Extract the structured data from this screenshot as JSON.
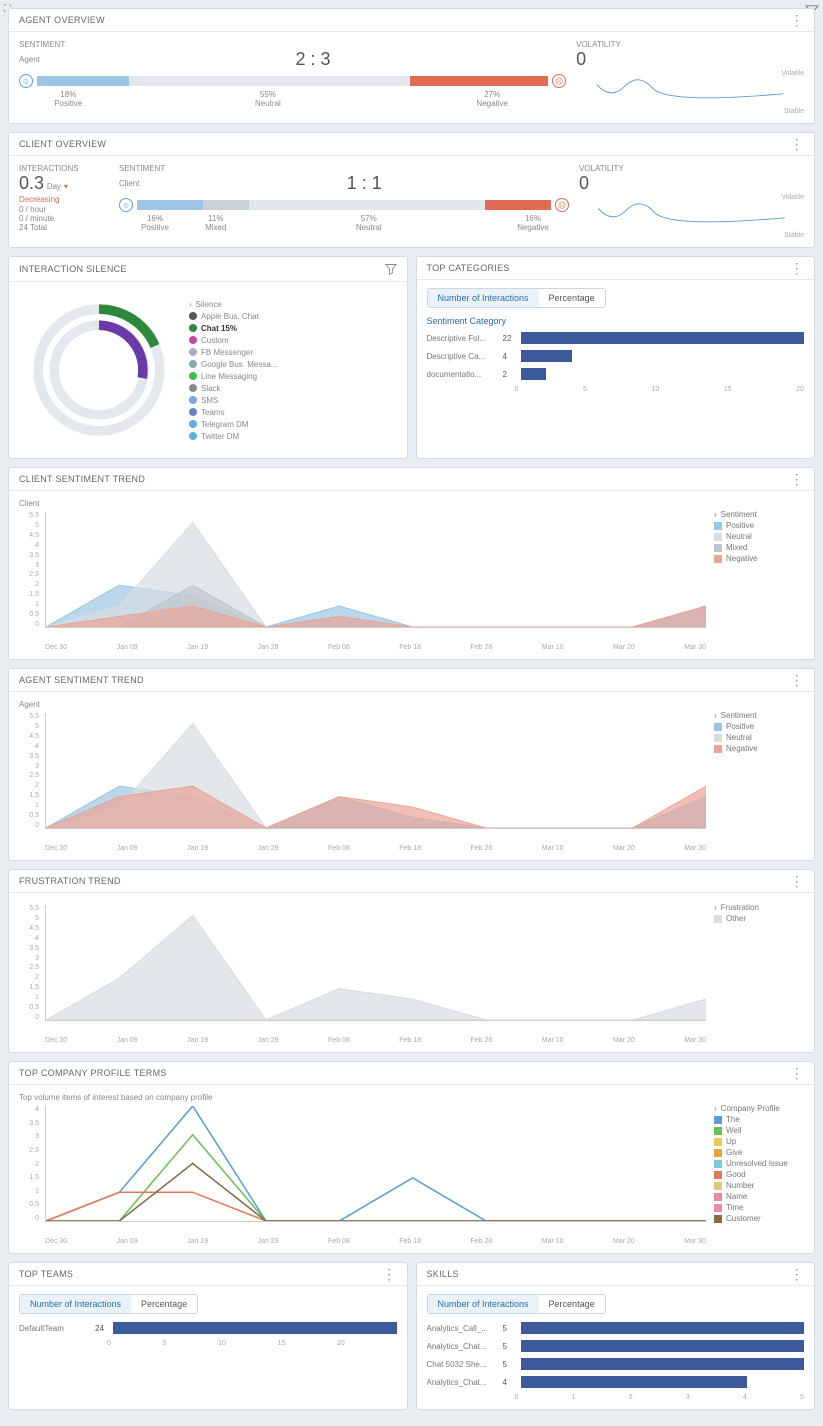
{
  "agent_overview": {
    "title": "AGENT OVERVIEW",
    "sentiment_label": "SENTIMENT",
    "sub": "Agent",
    "ratio": "2 : 3",
    "segments": [
      {
        "pct": 18,
        "label": "Positive",
        "color": "#9cc6e4"
      },
      {
        "pct": 55,
        "label": "Neutral",
        "color": "#e3e8ec"
      },
      {
        "pct": 27,
        "label": "Negative",
        "color": "#e06a52"
      }
    ],
    "volatility_label": "VOLATILITY",
    "volatility": "0",
    "vol_note": "Volatile",
    "vol_foot": "Stable"
  },
  "client_overview": {
    "title": "CLIENT OVERVIEW",
    "interactions_label": "INTERACTIONS",
    "interactions": "0.3",
    "interactions_unit": "Day",
    "trend": "Decreasing",
    "lines": [
      "0 / hour",
      "0 / minute",
      "24 Total"
    ],
    "sentiment_label": "SENTIMENT",
    "sub": "Client",
    "ratio": "1 : 1",
    "segments": [
      {
        "pct": 16,
        "label": "Positive",
        "color": "#9cc6e4"
      },
      {
        "pct": 11,
        "label": "Mixed",
        "color": "#c9d2d9"
      },
      {
        "pct": 57,
        "label": "Neutral",
        "color": "#e3e8ec"
      },
      {
        "pct": 16,
        "label": "Negative",
        "color": "#e06a52"
      }
    ],
    "volatility_label": "VOLATILITY",
    "volatility": "0",
    "vol_note": "Volatile",
    "vol_foot": "Stable"
  },
  "interaction_silence": {
    "title": "INTERACTION SILENCE",
    "group": "Silence",
    "items": [
      {
        "label": "Apple Bus. Chat",
        "color": "#555"
      },
      {
        "label": "Chat 15%",
        "color": "#2a8a3a",
        "bold": true
      },
      {
        "label": "Custom",
        "color": "#c04aa8"
      },
      {
        "label": "FB Messenger",
        "color": "#b6a3d8"
      },
      {
        "label": "Google Bus. Messa...",
        "color": "#8aa"
      },
      {
        "label": "Line Messaging",
        "color": "#3bbf4a"
      },
      {
        "label": "Slack",
        "color": "#888"
      },
      {
        "label": "SMS",
        "color": "#7aa8d8"
      },
      {
        "label": "Teams",
        "color": "#6a7fc4"
      },
      {
        "label": "Telegram DM",
        "color": "#5ab3d8"
      },
      {
        "label": "Twitter DM",
        "color": "#5ab3d8"
      }
    ]
  },
  "top_categories": {
    "title": "TOP CATEGORIES",
    "tabs": [
      "Number of Interactions",
      "Percentage"
    ],
    "active_tab": 0,
    "subtitle": "Sentiment Category",
    "rows": [
      {
        "label": "Descriptive Fol...",
        "val": 22
      },
      {
        "label": "Descriptive Ca...",
        "val": 4
      },
      {
        "label": "documentatio...",
        "val": 2
      }
    ],
    "ticks": [
      "0",
      "5",
      "10",
      "15",
      "20"
    ],
    "max": 22
  },
  "trend_common": {
    "yticks": [
      "0",
      "0.5",
      "1",
      "1.5",
      "2",
      "2.5",
      "3",
      "3.5",
      "4",
      "4.5",
      "5",
      "5.5"
    ],
    "xticks": [
      "Dec 30",
      "Jan 09",
      "Jan 19",
      "Jan 29",
      "Feb 08",
      "Feb 18",
      "Feb 28",
      "Mar 10",
      "Mar 20",
      "Mar 30"
    ]
  },
  "client_trend": {
    "title": "CLIENT SENTIMENT TREND",
    "sub": "Client",
    "legend": [
      {
        "label": "Sentiment",
        "group": true
      },
      {
        "label": "Positive",
        "color": "#9cc6e4"
      },
      {
        "label": "Neutral",
        "color": "#d8dde1"
      },
      {
        "label": "Mixed",
        "color": "#bfc6cc"
      },
      {
        "label": "Negative",
        "color": "#e9a598"
      }
    ]
  },
  "agent_trend": {
    "title": "AGENT SENTIMENT TREND",
    "sub": "Agent",
    "legend": [
      {
        "label": "Sentiment",
        "group": true
      },
      {
        "label": "Positive",
        "color": "#9cc6e4"
      },
      {
        "label": "Neutral",
        "color": "#d8dde1"
      },
      {
        "label": "Negative",
        "color": "#e9a598"
      }
    ]
  },
  "frustration": {
    "title": "FRUSTRATION TREND",
    "legend": [
      {
        "label": "Frustration",
        "group": true
      },
      {
        "label": "Other",
        "color": "#d8dde1"
      }
    ]
  },
  "company_terms": {
    "title": "TOP COMPANY PROFILE TERMS",
    "sub": "Top volume items of interest based on company profile",
    "yticks": [
      "0",
      "0.5",
      "1",
      "1.5",
      "2",
      "2.5",
      "3",
      "3.5",
      "4"
    ],
    "legend": [
      {
        "label": "Company Profile",
        "group": true
      },
      {
        "label": "The",
        "color": "#5a9bd4"
      },
      {
        "label": "Well",
        "color": "#6abf5a"
      },
      {
        "label": "Up",
        "color": "#e8c95a"
      },
      {
        "label": "Give",
        "color": "#e8a23a"
      },
      {
        "label": "Unresolved Issue",
        "color": "#7ac8d8"
      },
      {
        "label": "Good",
        "color": "#e07a5a"
      },
      {
        "label": "Number",
        "color": "#d8c97a"
      },
      {
        "label": "Name",
        "color": "#e88a9a"
      },
      {
        "label": "Time",
        "color": "#e88aaa"
      },
      {
        "label": "Customer",
        "color": "#8a6a4a"
      }
    ]
  },
  "top_teams": {
    "title": "TOP TEAMS",
    "tabs": [
      "Number of Interactions",
      "Percentage"
    ],
    "active_tab": 0,
    "rows": [
      {
        "label": "DefaultTeam",
        "val": 24
      }
    ],
    "ticks": [
      "0",
      "5",
      "10",
      "15",
      "20",
      ""
    ],
    "max": 24
  },
  "skills": {
    "title": "SKILLS",
    "tabs": [
      "Number of Interactions",
      "Percentage"
    ],
    "active_tab": 0,
    "rows": [
      {
        "label": "Analytics_Call_...",
        "val": 5
      },
      {
        "label": "Analytics_Chat...",
        "val": 5
      },
      {
        "label": "Chat 5032 She...",
        "val": 5
      },
      {
        "label": "Analytics_Chat...",
        "val": 4
      }
    ],
    "ticks": [
      "0",
      "1",
      "2",
      "3",
      "4",
      "5"
    ],
    "max": 5
  },
  "chart_data": [
    {
      "type": "bar",
      "title": "Agent Sentiment",
      "categories": [
        "Positive",
        "Neutral",
        "Negative"
      ],
      "values": [
        18,
        55,
        27
      ],
      "ylabel": "%"
    },
    {
      "type": "bar",
      "title": "Client Sentiment",
      "categories": [
        "Positive",
        "Mixed",
        "Neutral",
        "Negative"
      ],
      "values": [
        16,
        11,
        57,
        16
      ],
      "ylabel": "%"
    },
    {
      "type": "bar",
      "title": "Top Categories — Number of Interactions",
      "categories": [
        "Descriptive Fol...",
        "Descriptive Ca...",
        "documentatio..."
      ],
      "values": [
        22,
        4,
        2
      ],
      "xlim": [
        0,
        22
      ]
    },
    {
      "type": "area",
      "title": "Client Sentiment Trend",
      "x": [
        "Dec 30",
        "Jan 09",
        "Jan 19",
        "Jan 29",
        "Feb 08",
        "Feb 18",
        "Feb 28",
        "Mar 10",
        "Mar 20",
        "Mar 30"
      ],
      "series": [
        {
          "name": "Positive",
          "values": [
            0,
            2,
            1.5,
            0,
            1,
            0,
            0,
            0,
            0,
            1
          ]
        },
        {
          "name": "Neutral",
          "values": [
            0,
            1,
            5,
            0,
            0,
            0,
            0,
            0,
            0,
            0
          ]
        },
        {
          "name": "Mixed",
          "values": [
            0,
            0,
            2,
            0,
            0,
            0,
            0,
            0,
            0,
            0
          ]
        },
        {
          "name": "Negative",
          "values": [
            0,
            0.5,
            1,
            0,
            0.5,
            0,
            0,
            0,
            0,
            1
          ]
        }
      ],
      "ylim": [
        0,
        5.5
      ]
    },
    {
      "type": "area",
      "title": "Agent Sentiment Trend",
      "x": [
        "Dec 30",
        "Jan 09",
        "Jan 19",
        "Jan 29",
        "Feb 08",
        "Feb 18",
        "Feb 28",
        "Mar 10",
        "Mar 20",
        "Mar 30"
      ],
      "series": [
        {
          "name": "Positive",
          "values": [
            0,
            2,
            1.5,
            0,
            1.5,
            0.5,
            0,
            0,
            0,
            1.5
          ]
        },
        {
          "name": "Neutral",
          "values": [
            0,
            1,
            5,
            0,
            0,
            0,
            0,
            0,
            0,
            0
          ]
        },
        {
          "name": "Negative",
          "values": [
            0,
            1.5,
            2,
            0,
            1.5,
            1,
            0,
            0,
            0,
            2
          ]
        }
      ],
      "ylim": [
        0,
        5.5
      ]
    },
    {
      "type": "area",
      "title": "Frustration Trend",
      "x": [
        "Dec 30",
        "Jan 09",
        "Jan 19",
        "Jan 29",
        "Feb 08",
        "Feb 18",
        "Feb 28",
        "Mar 10",
        "Mar 20",
        "Mar 30"
      ],
      "series": [
        {
          "name": "Other",
          "values": [
            0,
            2,
            5,
            0,
            1.5,
            1,
            0,
            0,
            0,
            1
          ]
        }
      ],
      "ylim": [
        0,
        5.5
      ]
    },
    {
      "type": "line",
      "title": "Top Company Profile Terms",
      "x": [
        "Dec 30",
        "Jan 09",
        "Jan 19",
        "Jan 29",
        "Feb 08",
        "Feb 18",
        "Feb 28",
        "Mar 10",
        "Mar 20",
        "Mar 30"
      ],
      "series": [
        {
          "name": "The",
          "values": [
            0,
            1,
            4,
            0,
            0,
            1.5,
            0,
            0,
            0,
            0
          ]
        },
        {
          "name": "Well",
          "values": [
            0,
            0,
            3,
            0,
            0,
            0,
            0,
            0,
            0,
            0
          ]
        },
        {
          "name": "Good",
          "values": [
            0,
            1,
            1,
            0,
            0,
            0,
            0,
            0,
            0,
            0
          ]
        },
        {
          "name": "Customer",
          "values": [
            0,
            0,
            2,
            0,
            0,
            0,
            0,
            0,
            0,
            0
          ]
        }
      ],
      "ylim": [
        0,
        4
      ]
    },
    {
      "type": "bar",
      "title": "Top Teams — Number of Interactions",
      "categories": [
        "DefaultTeam"
      ],
      "values": [
        24
      ],
      "xlim": [
        0,
        25
      ]
    },
    {
      "type": "bar",
      "title": "Skills — Number of Interactions",
      "categories": [
        "Analytics_Call_...",
        "Analytics_Chat...",
        "Chat 5032 She...",
        "Analytics_Chat..."
      ],
      "values": [
        5,
        5,
        5,
        4
      ],
      "xlim": [
        0,
        5
      ]
    }
  ]
}
